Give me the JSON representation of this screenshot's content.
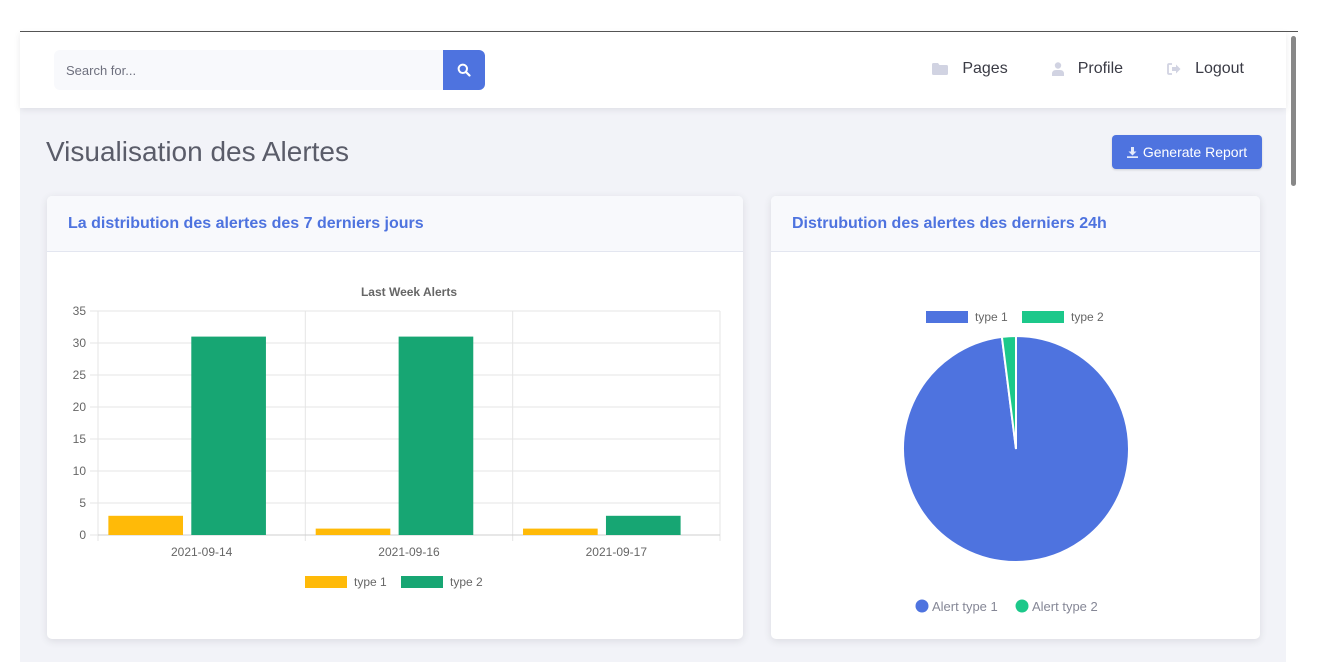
{
  "search": {
    "placeholder": "Search for..."
  },
  "nav": [
    {
      "label": "Pages",
      "icon": "folder-icon"
    },
    {
      "label": "Profile",
      "icon": "user-icon"
    },
    {
      "label": "Logout",
      "icon": "sign-out-icon"
    }
  ],
  "page": {
    "title": "Visualisation des Alertes",
    "report_button": "Generate Report"
  },
  "cards": {
    "week": {
      "title": "La distribution des alertes des 7 derniers jours"
    },
    "day": {
      "title": "Distrubution des alertes des derniers 24h"
    }
  },
  "colors": {
    "primary": "#4e73df",
    "type1_bar": "#ffba08",
    "type2_bar": "#17a673",
    "pie_type1": "#4e73df",
    "pie_type2": "#1cc88a"
  },
  "chart_data": [
    {
      "type": "bar",
      "title": "Last Week Alerts",
      "categories": [
        "2021-09-14",
        "2021-09-16",
        "2021-09-17"
      ],
      "series": [
        {
          "name": "type 1",
          "values": [
            3,
            1,
            1
          ]
        },
        {
          "name": "type 2",
          "values": [
            31,
            31,
            3
          ]
        }
      ],
      "ylim": [
        0,
        35
      ],
      "yticks": [
        0,
        5,
        10,
        15,
        20,
        25,
        30,
        35
      ],
      "grid": true,
      "legend": "bottom"
    },
    {
      "type": "pie",
      "labels": [
        "type 1",
        "type 2"
      ],
      "bottom_labels": [
        "Alert type 1",
        "Alert type 2"
      ],
      "values": [
        64,
        1.3
      ],
      "legend": "top"
    }
  ]
}
